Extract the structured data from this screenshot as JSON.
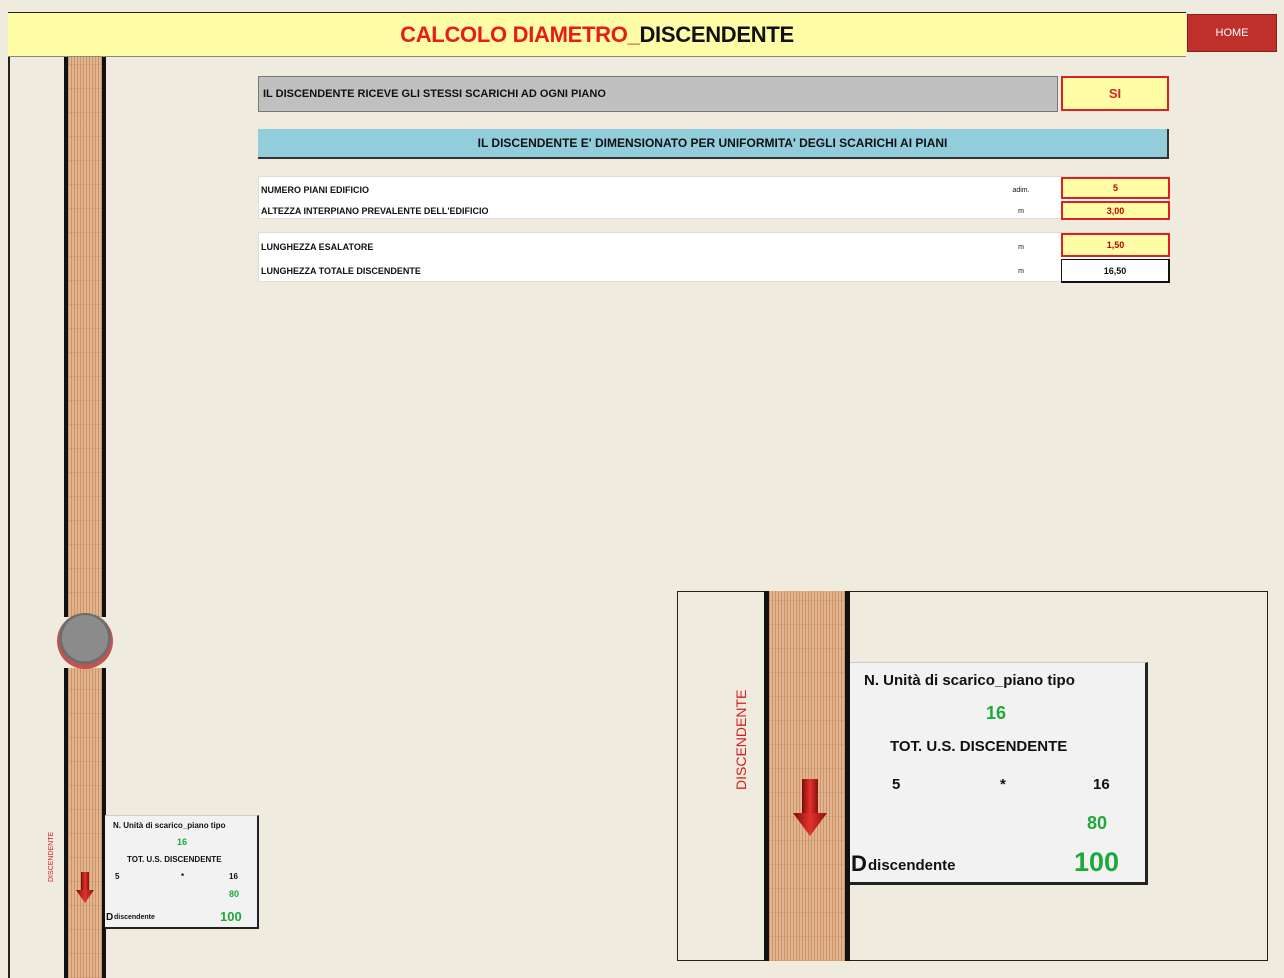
{
  "title": {
    "red": "CALCOLO DIAMETRO_",
    "black": "DISCENDENTE"
  },
  "home_label": "HOME",
  "question": {
    "label": "IL DISCENDENTE RICEVE GLI STESSI SCARICHI AD OGNI PIANO",
    "value": "SI"
  },
  "banner": "IL DISCENDENTE E' DIMENSIONATO PER UNIFORMITA' DEGLI SCARICHI AI PIANI",
  "rows": [
    {
      "label": "NUMERO PIANI EDIFICIO",
      "unit": "adim.",
      "value": "5"
    },
    {
      "label": "ALTEZZA  INTERPIANO PREVALENTE DELL'EDIFICIO",
      "unit": "m",
      "value": "3,00"
    },
    {
      "label": "LUNGHEZZA ESALATORE",
      "unit": "m",
      "value": "1,50"
    },
    {
      "label": "LUNGHEZZA TOTALE DISCENDENTE",
      "unit": "m",
      "value": "16,50"
    }
  ],
  "diagram": {
    "pipe_label": "DISCENDENTE",
    "us_piano_label": "N. Unità di scarico_piano tipo",
    "us_piano_value": "16",
    "tot_label": "TOT.  U.S. DISCENDENTE",
    "floors": "5",
    "times": "*",
    "us_per_floor": "16",
    "tot_value": "80",
    "d_prefix": "D",
    "d_label": "discendente",
    "d_value": "100"
  },
  "colors": {
    "title_bar": "#fffda6",
    "title_red": "#ea1b1b",
    "home_button": "#c0302b",
    "input_fill": "#fffda6",
    "input_border": "#e02020",
    "banner": "#92cddc",
    "result_green": "#21a83b"
  }
}
